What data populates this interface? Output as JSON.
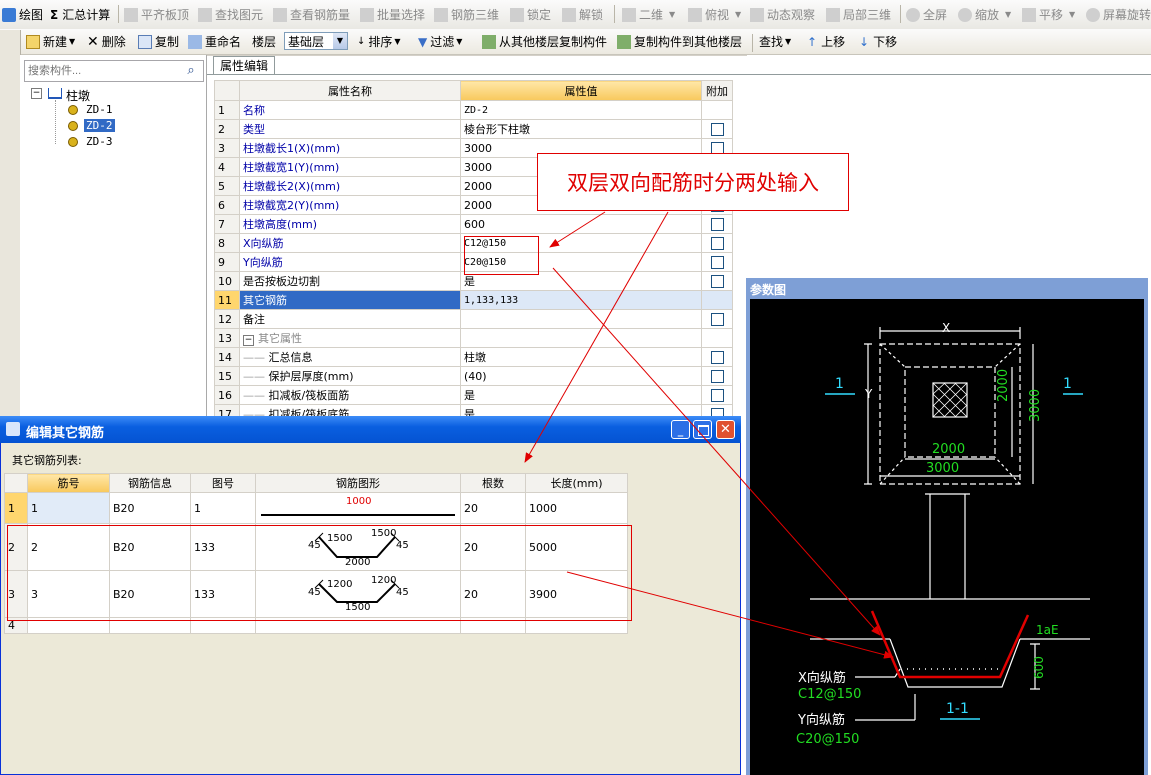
{
  "toolbar1": {
    "items": [
      "绘图",
      "汇总计算",
      "平齐板顶",
      "查找图元",
      "查看钢筋量",
      "批量选择",
      "钢筋三维",
      "锁定",
      "解锁",
      "二维",
      "俯视",
      "动态观察",
      "局部三维",
      "全屏",
      "缩放",
      "平移",
      "屏幕旋转"
    ]
  },
  "toolbar2": {
    "new": "新建",
    "delete": "删除",
    "copy": "复制",
    "rename": "重命名",
    "floor_label": "楼层",
    "floor_value": "基础层",
    "sort": "排序",
    "filter": "过滤",
    "copy_from": "从其他楼层复制构件",
    "copy_to": "复制构件到其他楼层",
    "find": "查找",
    "move_up": "上移",
    "move_down": "下移"
  },
  "left": {
    "search_placeholder": "搜索构件...",
    "tree_root": "柱墩",
    "tree_items": [
      "ZD-1",
      "ZD-2",
      "ZD-3"
    ]
  },
  "props": {
    "tab": "属性编辑",
    "headers": {
      "name": "属性名称",
      "value": "属性值",
      "extra": "附加"
    },
    "rows": [
      {
        "n": "1",
        "name": "名称",
        "value": "ZD-2"
      },
      {
        "n": "2",
        "name": "类型",
        "value": "棱台形下柱墩"
      },
      {
        "n": "3",
        "name": "柱墩截长1(X)(mm)",
        "value": "3000"
      },
      {
        "n": "4",
        "name": "柱墩截宽1(Y)(mm)",
        "value": "3000"
      },
      {
        "n": "5",
        "name": "柱墩截长2(X)(mm)",
        "value": "2000"
      },
      {
        "n": "6",
        "name": "柱墩截宽2(Y)(mm)",
        "value": "2000"
      },
      {
        "n": "7",
        "name": "柱墩高度(mm)",
        "value": "600"
      },
      {
        "n": "8",
        "name": "X向纵筋",
        "value": "C12@150"
      },
      {
        "n": "9",
        "name": "Y向纵筋",
        "value": "C20@150"
      },
      {
        "n": "10",
        "name": "是否按板边切割",
        "value": "是"
      },
      {
        "n": "11",
        "name": "其它钢筋",
        "value": "1,133,133"
      },
      {
        "n": "12",
        "name": "备注",
        "value": ""
      },
      {
        "n": "13",
        "name": "其它属性",
        "value": ""
      },
      {
        "n": "14",
        "name": "汇总信息",
        "value": "柱墩"
      },
      {
        "n": "15",
        "name": "保护层厚度(mm)",
        "value": "(40)"
      },
      {
        "n": "16",
        "name": "扣减板/筏板面筋",
        "value": "是"
      },
      {
        "n": "17",
        "name": "扣减板/筏板底筋",
        "value": "是"
      }
    ]
  },
  "annotation": {
    "text": "双层双向配筋时分两处输入"
  },
  "dialog": {
    "title": "编辑其它钢筋",
    "list_label": "其它钢筋列表:",
    "headers": [
      "筋号",
      "钢筋信息",
      "图号",
      "钢筋图形",
      "根数",
      "长度(mm)"
    ],
    "rows": [
      {
        "n": "1",
        "bar": "1",
        "info": "B20",
        "fig": "1",
        "count": "20",
        "length": "1000",
        "shape": {
          "top": "1000"
        }
      },
      {
        "n": "2",
        "bar": "2",
        "info": "B20",
        "fig": "133",
        "count": "20",
        "length": "5000",
        "shape": {
          "left": "45",
          "a": "1500",
          "b": "1500",
          "right": "45",
          "bottom": "2000"
        }
      },
      {
        "n": "3",
        "bar": "3",
        "info": "B20",
        "fig": "133",
        "count": "20",
        "length": "3900",
        "shape": {
          "left": "45",
          "a": "1200",
          "b": "1200",
          "right": "45",
          "bottom": "1500"
        }
      },
      {
        "n": "4",
        "bar": "",
        "info": "",
        "fig": "",
        "count": "",
        "length": ""
      }
    ]
  },
  "ref": {
    "title": "参数图",
    "plan": {
      "x": "X",
      "y": "Y",
      "d2000": "2000",
      "d3000": "3000",
      "sec": "1"
    },
    "section": {
      "lae": "1aE",
      "h600": "600",
      "xbar_label": "X向纵筋",
      "xbar_value": "C12@150",
      "ybar_label": "Y向纵筋",
      "ybar_value": "C20@150",
      "name": "1-1"
    }
  },
  "colors": {
    "accent_red": "#e00000",
    "cad_bg": "#000000",
    "cad_green": "#22dd22",
    "cad_cyan": "#33ddff",
    "selected": "#316ac5"
  }
}
